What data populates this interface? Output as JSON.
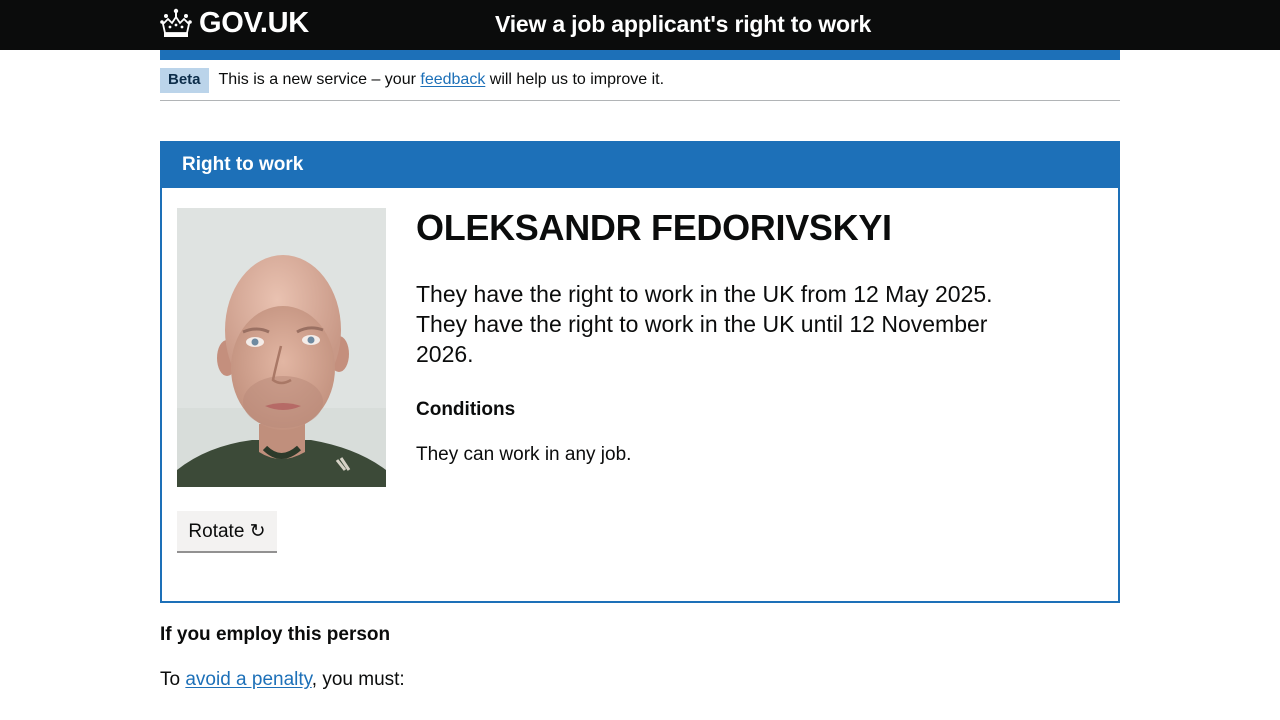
{
  "header": {
    "logo_text": "GOV.UK",
    "service_name": "View a job applicant's right to work"
  },
  "phase_banner": {
    "tag": "Beta",
    "text_before": "This is a new service – your ",
    "link_text": "feedback",
    "text_after": " will help us to improve it."
  },
  "panel": {
    "title": "Right to work",
    "person_name": "OLEKSANDR FEDORIVSKYI",
    "right_to_work_line1": "They have the right to work in the UK from 12 May 2025.",
    "right_to_work_line2": "They have the right to work in the UK until 12 November 2026.",
    "conditions_heading": "Conditions",
    "conditions_text": "They can work in any job.",
    "rotate_button": "Rotate ↻"
  },
  "employ": {
    "heading": "If you employ this person",
    "text_before": "To ",
    "link_text": "avoid a penalty",
    "text_after": ", you must:"
  },
  "colors": {
    "header_bg": "#0b0c0c",
    "brand_blue": "#1d70b8",
    "beta_tag_bg": "#bbd4ea",
    "button_bg": "#f3f2f1"
  }
}
